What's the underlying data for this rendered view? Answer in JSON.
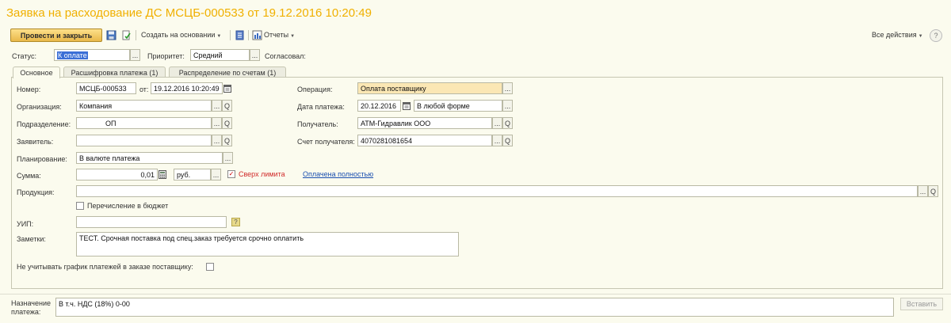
{
  "window": {
    "title": "Заявка на расходование ДС МСЦБ-000533 от 19.12.2016 10:20:49"
  },
  "toolbar": {
    "post_close_label": "Провести и закрыть",
    "create_based_label": "Создать на основании",
    "reports_label": "Отчеты",
    "all_actions_label": "Все действия",
    "help_label": "?"
  },
  "header": {
    "status_label": "Статус:",
    "status_value": "К оплате",
    "priority_label": "Приоритет:",
    "priority_value": "Средний",
    "approved_label": "Согласовал:",
    "approved_value": ""
  },
  "tabs": [
    {
      "label": "Основное",
      "active": true
    },
    {
      "label": "Расшифровка платежа (1)",
      "active": false
    },
    {
      "label": "Распределение по счетам (1)",
      "active": false
    }
  ],
  "form": {
    "number_label": "Номер:",
    "number_value": "МСЦБ-000533",
    "from_label": "от:",
    "date_value": "19.12.2016 10:20:49",
    "org_label": "Организация:",
    "org_value": "Компания",
    "subdivision_label": "Подразделение:",
    "subdivision_value": "ОП",
    "applicant_label": "Заявитель:",
    "applicant_value": "",
    "planning_label": "Планирование:",
    "planning_value": "В валюте платежа",
    "sum_label": "Сумма:",
    "sum_value": "0,01",
    "currency_value": "руб.",
    "over_limit_label": "Сверх лимита",
    "over_limit_checked": true,
    "paid_full_link": "Оплачена полностью",
    "operation_label": "Операция:",
    "operation_value": "Оплата поставщику",
    "pay_date_label": "Дата платежа:",
    "pay_date_value": "20.12.2016",
    "pay_form_value": "В любой форме",
    "recipient_label": "Получатель:",
    "recipient_value": "АТМ-Гидравлик ООО",
    "recipient_account_label": "Счет получателя:",
    "recipient_account_value": "4070281081654",
    "product_label": "Продукция:",
    "product_value": "",
    "budget_transfer_label": "Перечисление в бюджет",
    "budget_transfer_checked": false,
    "uip_label": "УИП:",
    "uip_value": "",
    "uip_help": "?",
    "notes_label": "Заметки:",
    "notes_value": "ТЕСТ. Срочная поставка под спец.заказ требуется срочно оплатить",
    "ignore_schedule_label": "Не учитывать график платежей в заказе поставщику:",
    "ignore_schedule_checked": false
  },
  "footer": {
    "purpose_label_1": "Назначение",
    "purpose_label_2": "платежа:",
    "purpose_value": "В т.ч. НДС (18%) 0-00",
    "insert_label": "Вставить"
  },
  "glyphs": {
    "ellipsis": "...",
    "magnifier": "Q",
    "tri": "▼"
  },
  "colors": {
    "title": "#f0b000",
    "primary_button": "#e9b84a",
    "operation_field": "#fbe7b4",
    "link": "#1a4fb0",
    "over_limit": "#d12a2a"
  }
}
